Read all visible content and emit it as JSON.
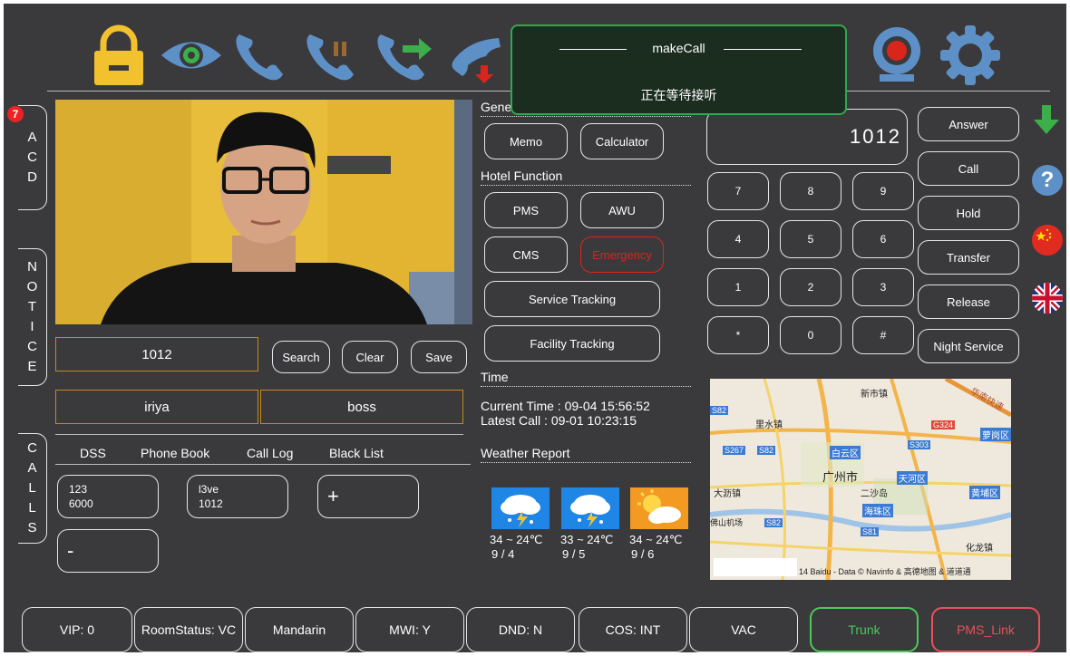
{
  "toolbar": {
    "icons": [
      "lock-icon",
      "eye-icon",
      "phone-icon",
      "phone-hold-icon",
      "phone-transfer-icon",
      "phone-hangup-icon",
      "contacts-icon",
      "screen-icon",
      "music-icon",
      "record-icon",
      "settings-icon"
    ]
  },
  "dialog": {
    "title": "makeCall",
    "message": "正在等待接听"
  },
  "side_tabs": {
    "acd": "ACD",
    "notice": "NOTICE",
    "calls": "CALLS",
    "acd_badge": "7"
  },
  "search": {
    "value": "1012",
    "search": "Search",
    "clear": "Clear",
    "save": "Save"
  },
  "user": {
    "name": "iriya",
    "role": "boss"
  },
  "tabs": {
    "dss": "DSS",
    "phonebook": "Phone Book",
    "calllog": "Call Log",
    "blacklist": "Black List"
  },
  "dss_cards": [
    {
      "line1": "123",
      "line2": "6000"
    },
    {
      "line1": "l3ve",
      "line2": "1012"
    }
  ],
  "dss_add": "+",
  "dss_remove": "-",
  "general": {
    "title": "General Function",
    "memo": "Memo",
    "calculator": "Calculator"
  },
  "hotel": {
    "title": "Hotel Function",
    "pms": "PMS",
    "awu": "AWU",
    "cms": "CMS",
    "emergency": "Emergency",
    "service": "Service Tracking",
    "facility": "Facility Tracking"
  },
  "time": {
    "title": "Time",
    "current": "Current Time : 09-04 15:56:52",
    "latest": "Latest Call : 09-01 10:23:15"
  },
  "weather": {
    "title": "Weather Report",
    "days": [
      {
        "temp": "34 ~ 24℃",
        "date": "9 / 4",
        "type": "thunderstorm"
      },
      {
        "temp": "33 ~ 24℃",
        "date": "9 / 5",
        "type": "thunderstorm"
      },
      {
        "temp": "34 ~ 24℃",
        "date": "9 / 6",
        "type": "partly-cloudy"
      }
    ]
  },
  "dialpad": {
    "display": "1012",
    "keys": [
      "7",
      "8",
      "9",
      "4",
      "5",
      "6",
      "1",
      "2",
      "3",
      "*",
      "0",
      "#"
    ]
  },
  "call_actions": {
    "answer": "Answer",
    "call": "Call",
    "hold": "Hold",
    "transfer": "Transfer",
    "release": "Release",
    "night": "Night Service"
  },
  "map": {
    "labels": {
      "xinshi": "新市镇",
      "lishui": "里水镇",
      "baiyun": "白云区",
      "guangzhou": "广州市",
      "tianhe": "天河区",
      "dali": "大沥镇",
      "ershadao": "二沙岛",
      "huangpu": "黄埔区",
      "haizhu": "海珠区",
      "luogang": "萝岗区",
      "huangpu_road": "华南快速",
      "huangpu2": "化龙镇",
      "jichang": "佛山机场"
    },
    "roads": {
      "s82a": "S82",
      "s267": "S267",
      "s82b": "S82",
      "g324": "G324",
      "s303": "S303",
      "s82c": "S82",
      "s81": "S81"
    },
    "copyright": "14 Baidu - Data © Navinfo & 高德地图 & 道道通"
  },
  "status_bar": {
    "vip": "VIP: 0",
    "room": "RoomStatus: VC",
    "lang": "Mandarin",
    "mwi": "MWI: Y",
    "dnd": "DND: N",
    "cos": "COS: INT",
    "vac": "VAC",
    "trunk": "Trunk",
    "pms_link": "PMS_Link"
  },
  "colors": {
    "bg": "#3a3a3c",
    "accent_orange": "#c48a1e",
    "emergency": "#d9251c",
    "trunk": "#4cc85a",
    "pms_link": "#e8505b",
    "dialog_border": "#2fa84f",
    "icon_blue": "#5e90c8",
    "icon_yellow": "#f2c12e"
  }
}
